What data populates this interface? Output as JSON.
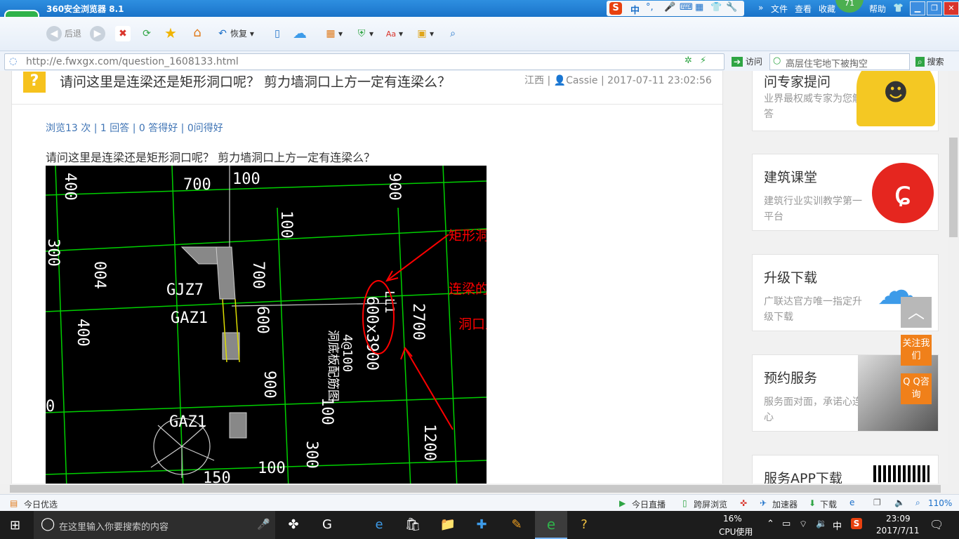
{
  "window": {
    "title": "360安全浏览器 8.1",
    "weather_badge": "71"
  },
  "menu": {
    "file": "文件",
    "view": "查看",
    "favorites": "收藏",
    "help": "帮助"
  },
  "ime": {
    "label": "中"
  },
  "toolbar": {
    "back": "后退",
    "restore": "恢复"
  },
  "address": {
    "url": "http://e.fwxgx.com/question_1608133.html",
    "visit": "访问",
    "search_value": "高层住宅地下被掏空",
    "search_button": "搜索"
  },
  "question": {
    "icon": "?",
    "title": "请问这里是连梁还是矩形洞口呢？ 剪力墙洞口上方一定有连梁么？",
    "meta_region": "江西",
    "meta_user": "Cassie",
    "meta_time": "2017-07-11 23:02:56",
    "stats": "浏览13 次 | 1 回答 | 0 答得好 | 0问得好",
    "body": "请问这里是连梁还是矩形洞口呢？ 剪力墙洞口上方一定有连梁么？"
  },
  "cad": {
    "dims": [
      "700",
      "100",
      "900",
      "400",
      "300",
      "004",
      "100",
      "700",
      "400",
      "600",
      "2700",
      "900",
      "100",
      "1200",
      "150",
      "100",
      "300",
      "0"
    ],
    "labels": [
      "GJZ7",
      "GAZ1",
      "GAZ1"
    ],
    "beam_text": "600x3900",
    "beam_sub": "LL1",
    "rebar_text": "4@100",
    "note_vertical": "洞底板配筋图",
    "annotations": [
      "矩形洞口",
      "连梁的截面尺寸查一下连梁表格",
      "洞口上方有连梁"
    ],
    "colors": {
      "line": "#00d000",
      "text": "#ffffff",
      "annot": "#ff0000",
      "wall": "#888888"
    }
  },
  "sidebar": [
    {
      "title": "问专家提问",
      "sub": "业界最权威专家为您解答"
    },
    {
      "title": "建筑课堂",
      "sub": "建筑行业实训教学第一平台"
    },
    {
      "title": "升级下载",
      "sub": "广联达官方唯一指定升级下载"
    },
    {
      "title": "预约服务",
      "sub": "服务面对面，承诺心连心"
    },
    {
      "title": "服务APP下载",
      "sub": ""
    }
  ],
  "float": {
    "follow": "关注我们",
    "qq": "Q Q咨询"
  },
  "statusbar": {
    "left": "今日优选",
    "live": "今日直播",
    "screen": "跨屏浏览",
    "accel": "加速器",
    "download": "下载",
    "zoom": "110%"
  },
  "taskbar": {
    "search_placeholder": "在这里输入你要搜索的内容",
    "cpu_pct": "16%",
    "cpu_label": "CPU使用",
    "ime": "中",
    "time": "23:09",
    "date": "2017/7/11"
  }
}
